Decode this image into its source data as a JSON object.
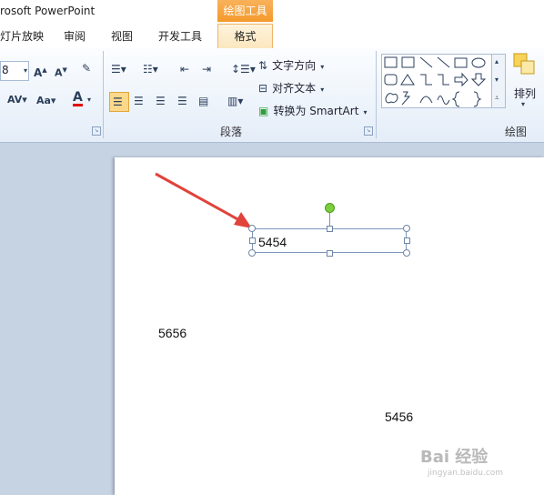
{
  "window": {
    "title": "rosoft PowerPoint"
  },
  "context_tab": {
    "header": "绘图工具",
    "label": "格式"
  },
  "tabs": [
    {
      "label": "灯片放映"
    },
    {
      "label": "审阅"
    },
    {
      "label": "视图"
    },
    {
      "label": "开发工具"
    }
  ],
  "font": {
    "size_value": "8"
  },
  "paragraph": {
    "text_direction": "文字方向",
    "align_text": "对齐文本",
    "convert_smartart": "转换为 SmartArt",
    "group_label": "段落"
  },
  "drawing": {
    "arrange": "排列",
    "group_label": "绘图"
  },
  "slide": {
    "selected_textbox": "5454",
    "text_1": "5656",
    "text_2": "5456"
  },
  "watermark": {
    "brand": "Bai 经验",
    "url": "jingyan.baidu.com"
  },
  "colors": {
    "accent_orange": "#f49a2b",
    "arrow_red": "#e0433b",
    "rotate_handle": "#7ccf3a"
  }
}
